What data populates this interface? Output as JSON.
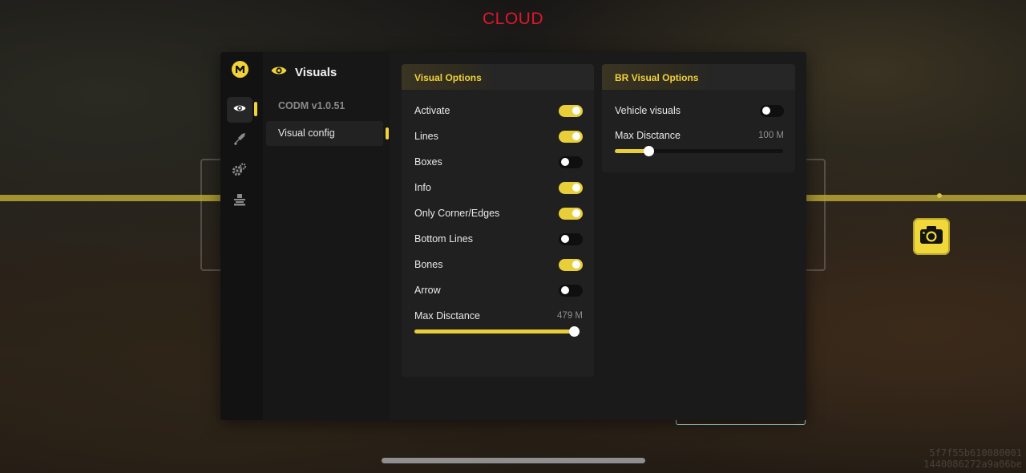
{
  "overlay_title": "CLOUD",
  "watermark": [
    "5f7f55b610080001",
    "1440086272a9a06be"
  ],
  "colors": {
    "accent": "#f0d33a",
    "title_red": "#e0162e",
    "panel": "#141414"
  },
  "rail": {
    "items": [
      {
        "icon": "eye-icon",
        "active": true
      },
      {
        "icon": "rifle-icon",
        "active": false
      },
      {
        "icon": "gears-icon",
        "active": false
      },
      {
        "icon": "turret-icon",
        "active": false
      }
    ]
  },
  "nav": {
    "title": "Visuals",
    "items": [
      {
        "label": "CODM v1.0.51",
        "active": false
      },
      {
        "label": "Visual config",
        "active": true
      }
    ]
  },
  "visual_options": {
    "header": "Visual Options",
    "toggles": [
      {
        "label": "Activate",
        "on": true
      },
      {
        "label": "Lines",
        "on": true
      },
      {
        "label": "Boxes",
        "on": false
      },
      {
        "label": "Info",
        "on": true
      },
      {
        "label": "Only Corner/Edges",
        "on": true
      },
      {
        "label": "Bottom Lines",
        "on": false
      },
      {
        "label": "Bones",
        "on": true
      },
      {
        "label": "Arrow",
        "on": false
      }
    ],
    "slider": {
      "label": "Max Disctance",
      "value_text": "479 M",
      "fraction": 1.0
    }
  },
  "br_options": {
    "header": "BR Visual Options",
    "toggles": [
      {
        "label": "Vehicle visuals",
        "on": false
      }
    ],
    "slider": {
      "label": "Max Disctance",
      "value_text": "100 M",
      "fraction": 0.2
    }
  }
}
